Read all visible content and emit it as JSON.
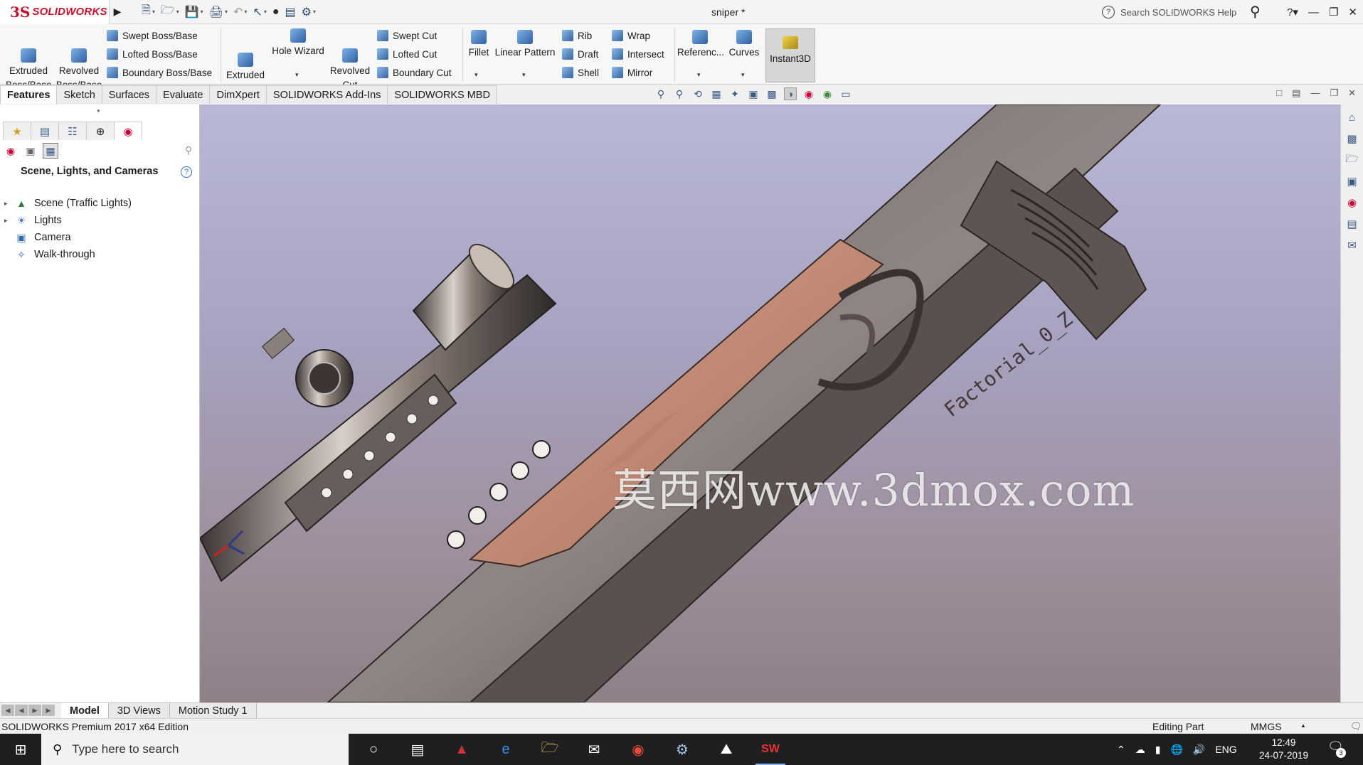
{
  "app": {
    "brand_mark": "3S",
    "brand_name": "SOLIDWORKS",
    "document_title": "sniper *",
    "help_search_placeholder": "Search SOLIDWORKS Help"
  },
  "ribbon": {
    "extruded_boss": "Extruded\nBoss/Base",
    "revolved_boss": "Revolved\nBoss/Base",
    "swept_boss": "Swept Boss/Base",
    "lofted_boss": "Lofted Boss/Base",
    "boundary_boss": "Boundary Boss/Base",
    "extruded_cut": "Extruded\nCut",
    "hole_wizard": "Hole Wizard",
    "revolved_cut": "Revolved\nCut",
    "swept_cut": "Swept Cut",
    "lofted_cut": "Lofted Cut",
    "boundary_cut": "Boundary Cut",
    "fillet": "Fillet",
    "linear_pattern": "Linear Pattern",
    "rib": "Rib",
    "draft": "Draft",
    "shell": "Shell",
    "wrap": "Wrap",
    "intersect": "Intersect",
    "mirror": "Mirror",
    "reference": "Referenc...",
    "curves": "Curves",
    "instant3d": "Instant3D"
  },
  "command_tabs": [
    "Features",
    "Sketch",
    "Surfaces",
    "Evaluate",
    "DimXpert",
    "SOLIDWORKS Add-Ins",
    "SOLIDWORKS MBD"
  ],
  "left_panel": {
    "title": "Scene, Lights, and Cameras",
    "tree": [
      {
        "label": "Scene (Traffic Lights)",
        "expandable": true,
        "icon": "scene-icon"
      },
      {
        "label": "Lights",
        "expandable": true,
        "icon": "lights-icon"
      },
      {
        "label": "Camera",
        "expandable": false,
        "icon": "camera-icon"
      },
      {
        "label": "Walk-through",
        "expandable": false,
        "icon": "walkthrough-icon"
      }
    ]
  },
  "viewport": {
    "watermark": "莫西网www.3dmox.com",
    "engraving": "Factorial_0_Z"
  },
  "bottom_tabs": [
    "Model",
    "3D Views",
    "Motion Study 1"
  ],
  "status": {
    "edition": "SOLIDWORKS Premium 2017 x64 Edition",
    "mode": "Editing Part",
    "units": "MMGS"
  },
  "taskbar": {
    "search_placeholder": "Type here to search",
    "lang": "ENG",
    "time": "12:49",
    "date": "24-07-2019",
    "notification_count": "3"
  },
  "colors": {
    "brand_red": "#c8102e",
    "viewport_top": "#b8b8d6",
    "viewport_bottom": "#8f7f87",
    "stock_copper": "#c98f78"
  }
}
